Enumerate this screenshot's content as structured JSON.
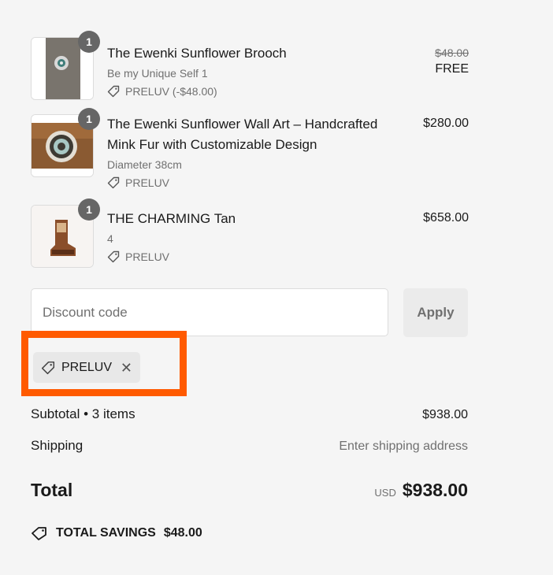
{
  "items": [
    {
      "quantity": "1",
      "title": "The Ewenki Sunflower Brooch",
      "variant": "Be my Unique Self 1",
      "discount": "PRELUV (-$48.00)",
      "original_price": "$48.00",
      "price": "FREE"
    },
    {
      "quantity": "1",
      "title": "The Ewenki Sunflower Wall Art – Handcrafted Mink Fur with Customizable Design",
      "variant": "Diameter 38cm",
      "discount": "PRELUV",
      "price": "$280.00"
    },
    {
      "quantity": "1",
      "title": "THE CHARMING Tan",
      "variant": "4",
      "discount": "PRELUV",
      "price": "$658.00"
    }
  ],
  "discount_form": {
    "placeholder": "Discount code",
    "apply_label": "Apply",
    "applied_code": "PRELUV"
  },
  "summary": {
    "subtotal_label": "Subtotal • 3 items",
    "subtotal_value": "$938.00",
    "shipping_label": "Shipping",
    "shipping_value": "Enter shipping address",
    "total_label": "Total",
    "currency": "USD",
    "total_value": "$938.00",
    "savings_label": "TOTAL SAVINGS",
    "savings_value": "$48.00"
  },
  "colors": {
    "highlight": "#ff5a00",
    "background": "#f5f5f5",
    "quantity_badge": "#666666"
  }
}
